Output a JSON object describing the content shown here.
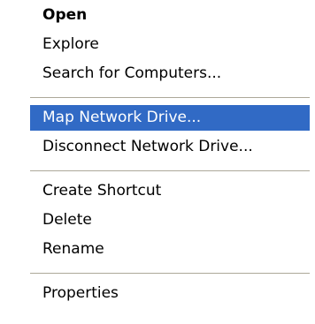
{
  "context_menu": {
    "items": [
      {
        "label": "Open",
        "bold": true
      },
      {
        "label": "Explore"
      },
      {
        "label": "Search for Computers..."
      },
      {
        "label": "Map Network Drive...",
        "selected": true
      },
      {
        "label": "Disconnect Network Drive..."
      },
      {
        "label": "Create Shortcut"
      },
      {
        "label": "Delete"
      },
      {
        "label": "Rename"
      },
      {
        "label": "Properties"
      }
    ]
  },
  "colors": {
    "selection_bg": "#316ac5",
    "selection_text": "#ffffff",
    "separator": "#aca899"
  }
}
